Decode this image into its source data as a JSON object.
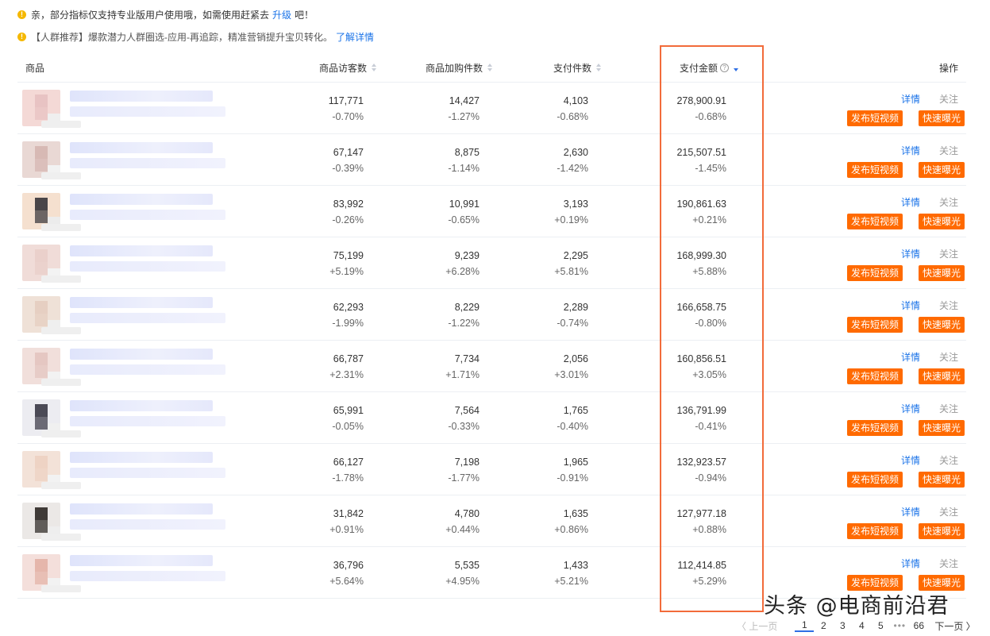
{
  "notices": {
    "upgrade": {
      "text": "亲，部分指标仅支持专业版用户使用哦，如需使用赶紧去",
      "link": "升级",
      "tail": "吧！"
    },
    "crowd": {
      "tag": "【人群推荐】",
      "text": "爆款潜力人群圈选-应用-再追踪，精准营销提升宝贝转化。",
      "link": "了解详情"
    }
  },
  "columns": {
    "product": "商品",
    "visitors": "商品访客数",
    "cart": "商品加购件数",
    "paid_items": "支付件数",
    "paid_amount": "支付金额",
    "actions": "操作"
  },
  "actions": {
    "detail": "详情",
    "follow": "关注",
    "publish_video": "发布短视频",
    "quick_expose": "快速曝光"
  },
  "rows": [
    {
      "visitors": "117,771",
      "visitors_change": "-0.70%",
      "cart": "14,427",
      "cart_change": "-1.27%",
      "paid_items": "4,103",
      "paid_items_change": "-0.68%",
      "paid_amount": "278,900.91",
      "paid_amount_change": "-0.68%"
    },
    {
      "visitors": "67,147",
      "visitors_change": "-0.39%",
      "cart": "8,875",
      "cart_change": "-1.14%",
      "paid_items": "2,630",
      "paid_items_change": "-1.42%",
      "paid_amount": "215,507.51",
      "paid_amount_change": "-1.45%"
    },
    {
      "visitors": "83,992",
      "visitors_change": "-0.26%",
      "cart": "10,991",
      "cart_change": "-0.65%",
      "paid_items": "3,193",
      "paid_items_change": "+0.19%",
      "paid_amount": "190,861.63",
      "paid_amount_change": "+0.21%"
    },
    {
      "visitors": "75,199",
      "visitors_change": "+5.19%",
      "cart": "9,239",
      "cart_change": "+6.28%",
      "paid_items": "2,295",
      "paid_items_change": "+5.81%",
      "paid_amount": "168,999.30",
      "paid_amount_change": "+5.88%"
    },
    {
      "visitors": "62,293",
      "visitors_change": "-1.99%",
      "cart": "8,229",
      "cart_change": "-1.22%",
      "paid_items": "2,289",
      "paid_items_change": "-0.74%",
      "paid_amount": "166,658.75",
      "paid_amount_change": "-0.80%"
    },
    {
      "visitors": "66,787",
      "visitors_change": "+2.31%",
      "cart": "7,734",
      "cart_change": "+1.71%",
      "paid_items": "2,056",
      "paid_items_change": "+3.01%",
      "paid_amount": "160,856.51",
      "paid_amount_change": "+3.05%"
    },
    {
      "visitors": "65,991",
      "visitors_change": "-0.05%",
      "cart": "7,564",
      "cart_change": "-0.33%",
      "paid_items": "1,765",
      "paid_items_change": "-0.40%",
      "paid_amount": "136,791.99",
      "paid_amount_change": "-0.41%"
    },
    {
      "visitors": "66,127",
      "visitors_change": "-1.78%",
      "cart": "7,198",
      "cart_change": "-1.77%",
      "paid_items": "1,965",
      "paid_items_change": "-0.91%",
      "paid_amount": "132,923.57",
      "paid_amount_change": "-0.94%"
    },
    {
      "visitors": "31,842",
      "visitors_change": "+0.91%",
      "cart": "4,780",
      "cart_change": "+0.44%",
      "paid_items": "1,635",
      "paid_items_change": "+0.86%",
      "paid_amount": "127,977.18",
      "paid_amount_change": "+0.88%"
    },
    {
      "visitors": "36,796",
      "visitors_change": "+5.64%",
      "cart": "5,535",
      "cart_change": "+4.95%",
      "paid_items": "1,433",
      "paid_items_change": "+5.21%",
      "paid_amount": "112,414.85",
      "paid_amount_change": "+5.29%"
    }
  ],
  "pagination": {
    "prev": "〈 上一页",
    "pages": [
      "1",
      "2",
      "3",
      "4",
      "5"
    ],
    "ellipsis": "•••",
    "last": "66",
    "next": "下一页 〉",
    "current": "1"
  },
  "watermark": "头条 @电商前沿君",
  "colors": {
    "accent_orange": "#ff6a00",
    "link_blue": "#1a73e8",
    "highlight_border": "#f26b3a",
    "warning_yellow": "#f5b800"
  },
  "icons": {
    "notice": "warning-icon",
    "sort": "sort-caret-icon",
    "help": "question-circle-icon"
  }
}
